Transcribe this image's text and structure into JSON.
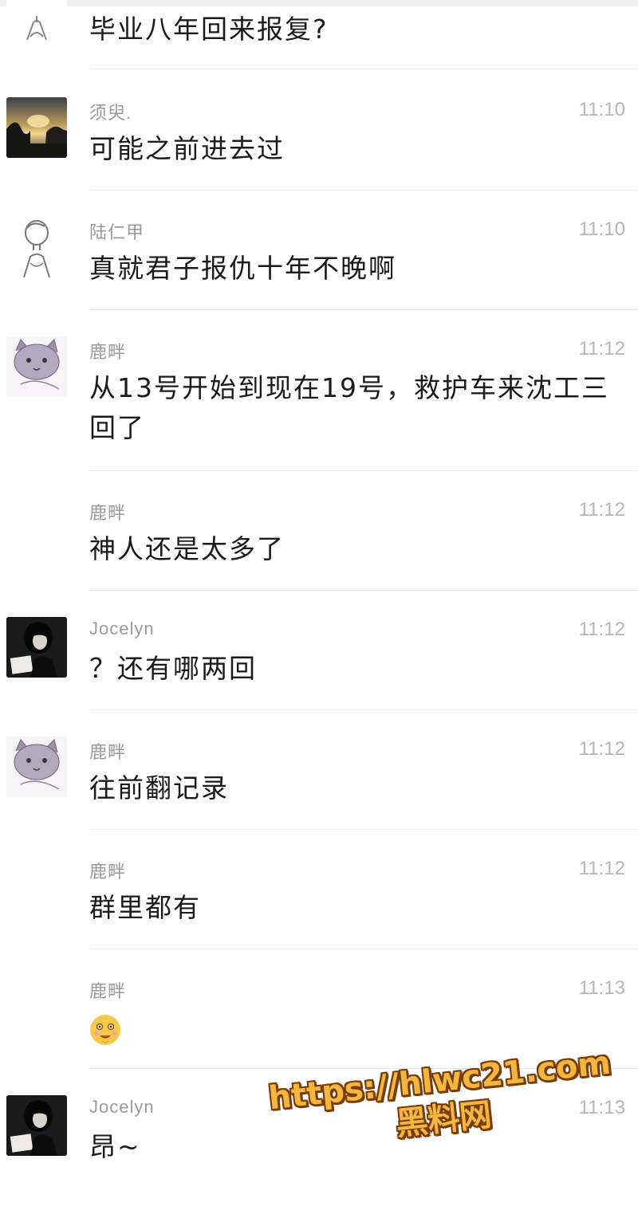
{
  "colors": {
    "background": "#ffffff",
    "sender_name": "#9a9a9a",
    "timestamp": "#b6b6b6",
    "message_text": "#1b1b1b",
    "watermark_fill": "#f3b63e",
    "watermark_outline": "#7a3c06"
  },
  "messages": [
    {
      "avatar": "sketch-person-avatar",
      "sender": "",
      "time": "",
      "text": "毕业八年回来报复?"
    },
    {
      "avatar": "sunset-photo-avatar",
      "sender": "须臾.",
      "time": "11:10",
      "text": "可能之前进去过"
    },
    {
      "avatar": "sketch-person-avatar",
      "sender": "陆仁甲",
      "time": "11:10",
      "text": "真就君子报仇十年不晚啊"
    },
    {
      "avatar": "cat-drawing-avatar",
      "sender": "鹿畔",
      "time": "11:12",
      "text": "从13号开始到现在19号，救护车来沈工三回了"
    },
    {
      "avatar": "",
      "sender": "鹿畔",
      "time": "11:12",
      "text": "神人还是太多了"
    },
    {
      "avatar": "portrait-photo-avatar",
      "sender": "Jocelyn",
      "time": "11:12",
      "text": "？还有哪两回"
    },
    {
      "avatar": "cat-drawing-avatar",
      "sender": "鹿畔",
      "time": "11:12",
      "text": "往前翻记录"
    },
    {
      "avatar": "",
      "sender": "鹿畔",
      "time": "11:12",
      "text": "群里都有"
    },
    {
      "avatar": "",
      "sender": "鹿畔",
      "time": "11:13",
      "text": "",
      "emoji": "smiling-face-emoji"
    },
    {
      "avatar": "portrait-photo-avatar",
      "sender": "Jocelyn",
      "time": "11:13",
      "text": "昂~"
    }
  ],
  "watermark": {
    "url": "https://hlwc21.com",
    "name": "黑料网"
  }
}
